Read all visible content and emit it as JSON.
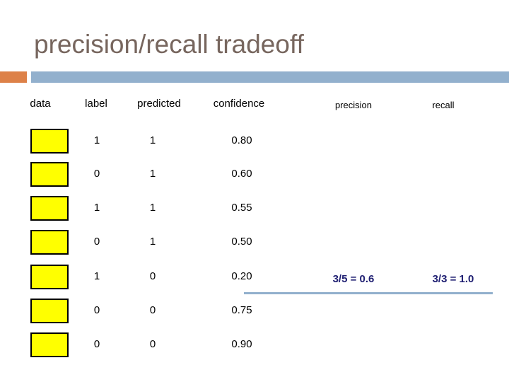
{
  "slide": {
    "title": "precision/recall tradeoff",
    "accent_orange": "#dd8148",
    "accent_blue": "#92b0cd",
    "title_color": "#77665e"
  },
  "table": {
    "headers": {
      "data": "data",
      "label": "label",
      "predicted": "predicted",
      "confidence": "confidence",
      "precision": "precision",
      "recall": "recall"
    },
    "swatch_color": "#ffff00",
    "rows": [
      {
        "data": "",
        "label": "1",
        "predicted": "1",
        "confidence": "0.80"
      },
      {
        "data": "",
        "label": "0",
        "predicted": "1",
        "confidence": "0.60"
      },
      {
        "data": "",
        "label": "1",
        "predicted": "1",
        "confidence": "0.55"
      },
      {
        "data": "",
        "label": "0",
        "predicted": "1",
        "confidence": "0.50"
      },
      {
        "data": "",
        "label": "1",
        "predicted": "0",
        "confidence": "0.20"
      },
      {
        "data": "",
        "label": "0",
        "predicted": "0",
        "confidence": "0.75"
      },
      {
        "data": "",
        "label": "0",
        "predicted": "0",
        "confidence": "0.90"
      }
    ]
  },
  "annotations": {
    "precision_value": "3/5 = 0.6",
    "recall_value": "3/3 = 1.0",
    "text_color": "#1f1f72",
    "threshold_line_color": "#92b0cd"
  }
}
